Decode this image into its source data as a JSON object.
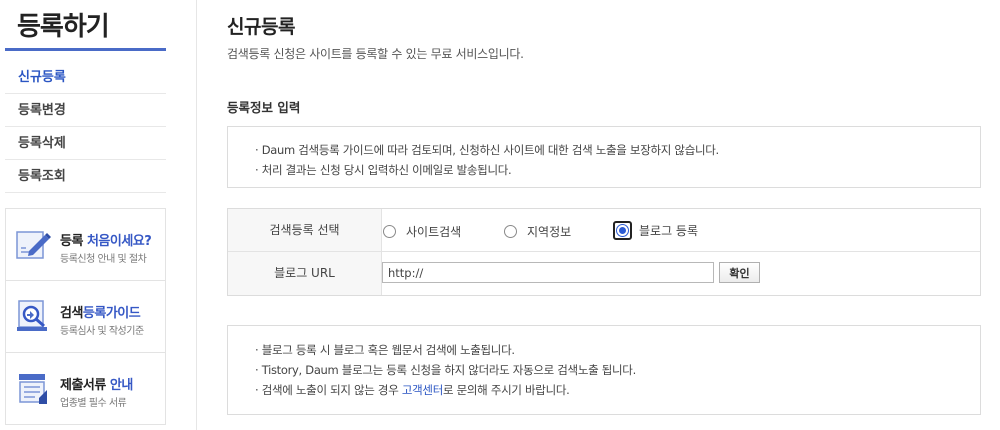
{
  "sidebar": {
    "title": "등록하기",
    "menu": [
      {
        "label": "신규등록",
        "active": true
      },
      {
        "label": "등록변경",
        "active": false
      },
      {
        "label": "등록삭제",
        "active": false
      },
      {
        "label": "등록조회",
        "active": false
      }
    ],
    "promos": [
      {
        "title_plain": "등록 ",
        "title_highlight": "처음이세요?",
        "subtitle": "등록신청 안내 및 절차",
        "icon": "pencil-document-icon"
      },
      {
        "title_plain": "검색",
        "title_highlight": "등록가이드",
        "subtitle": "등록심사 및 작성기준",
        "icon": "magnifier-document-icon"
      },
      {
        "title_plain": "제출서류 ",
        "title_highlight": "안내",
        "subtitle": "업종별 필수 서류",
        "icon": "document-stack-icon"
      }
    ],
    "accent_color": "#4a6bc7",
    "highlight_color": "#3658c5"
  },
  "main": {
    "title": "신규등록",
    "description": "검색등록 신청은 사이트를 등록할 수 있는 무료 서비스입니다.",
    "section_title": "등록정보 입력",
    "notice_top": [
      "· Daum 검색등록 가이드에 따라 검토되며, 신청하신 사이트에 대한 검색 노출을 보장하지 않습니다.",
      "· 처리 결과는 신청 당시 입력하신 이메일로 발송됩니다."
    ],
    "form": {
      "type_label": "검색등록 선택",
      "options": [
        {
          "label": "사이트검색",
          "selected": false
        },
        {
          "label": "지역정보",
          "selected": false
        },
        {
          "label": "블로그 등록",
          "selected": true
        }
      ],
      "url_label": "블로그 URL",
      "url_value": "http://",
      "confirm_label": "확인"
    },
    "notice_bottom": {
      "line1": "· 블로그 등록 시 블로그 혹은 웹문서 검색에 노출됩니다.",
      "line2": "· Tistory, Daum 블로그는 등록 신청을 하지 않더라도 자동으로 검색노출 됩니다.",
      "line3_prefix": "· 검색에 노출이 되지 않는 경우 ",
      "line3_link": "고객센터",
      "line3_suffix": "로 문의해 주시기 바랍니다."
    },
    "link_color": "#2a55c3"
  }
}
